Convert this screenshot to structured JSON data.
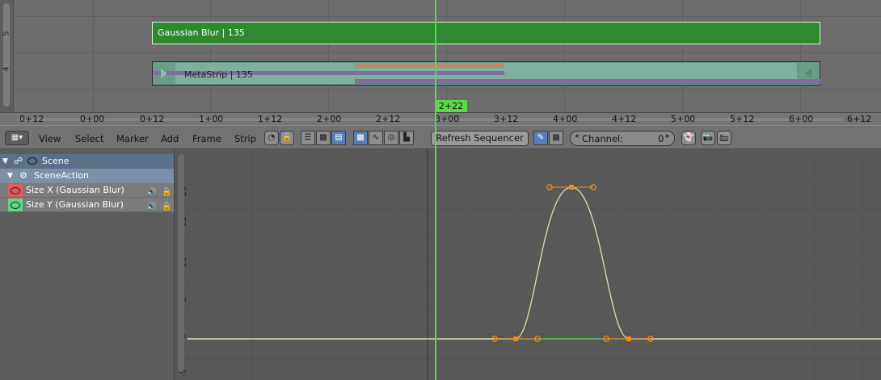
{
  "sequencer": {
    "channels": [
      "5",
      "4"
    ],
    "strips": {
      "gaussian_blur_label": "Gaussian Blur | 135",
      "metastrip_label": "MetaStrip | 135"
    },
    "current_frame": "2+22"
  },
  "time_ruler": {
    "ticks": [
      "0+12",
      "0+00",
      "0+12",
      "1+00",
      "1+12",
      "2+00",
      "2+12",
      "3+00",
      "3+12",
      "4+00",
      "4+12",
      "5+00",
      "5+12",
      "6+00",
      "6+12"
    ]
  },
  "toolbar": {
    "menus": [
      "View",
      "Select",
      "Marker",
      "Add",
      "Frame",
      "Strip"
    ],
    "refresh_label": "Refresh Sequencer",
    "channel_label": "Channel:",
    "channel_value": "0"
  },
  "channel_list": {
    "scene": "Scene",
    "action": "SceneAction",
    "fcurves": [
      {
        "label": "Size X (Gaussian Blur)",
        "color": "#e05a5a"
      },
      {
        "label": "Size Y (Gaussian Blur)",
        "color": "#5ad88a"
      }
    ]
  },
  "graph": {
    "y_ticks": [
      "20",
      "15",
      "10",
      "5",
      "0",
      "-5"
    ],
    "curve_color": "#d8d8a0",
    "keyframe_color": "#f08a1c"
  },
  "colors": {
    "playhead": "#5ad84a",
    "gaussian_blur_strip": "#2f8a2f",
    "metastrip": "#6a9c88"
  }
}
